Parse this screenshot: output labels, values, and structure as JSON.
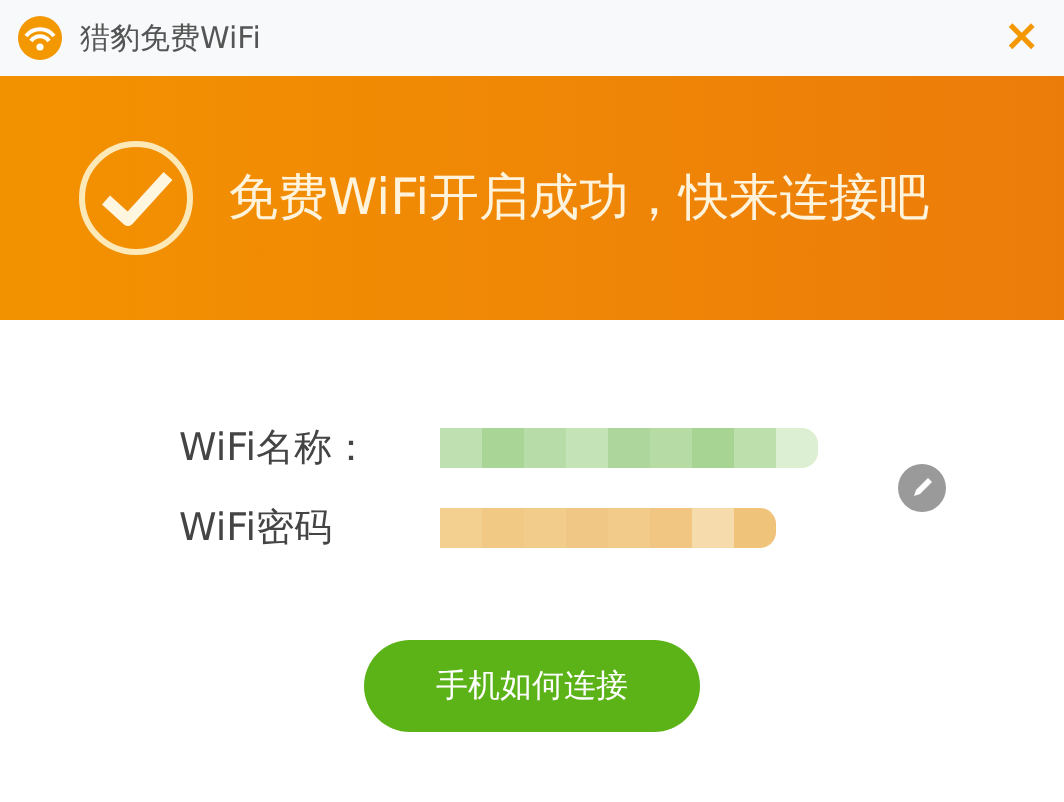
{
  "window": {
    "title": "猎豹免费WiFi",
    "close": "×"
  },
  "banner": {
    "message": "免费WiFi开启成功，快来连接吧"
  },
  "fields": [
    {
      "label": "WiFi名称：",
      "kind": "name"
    },
    {
      "label": "WiFi密码",
      "kind": "password"
    }
  ],
  "button": "手机如何连接"
}
